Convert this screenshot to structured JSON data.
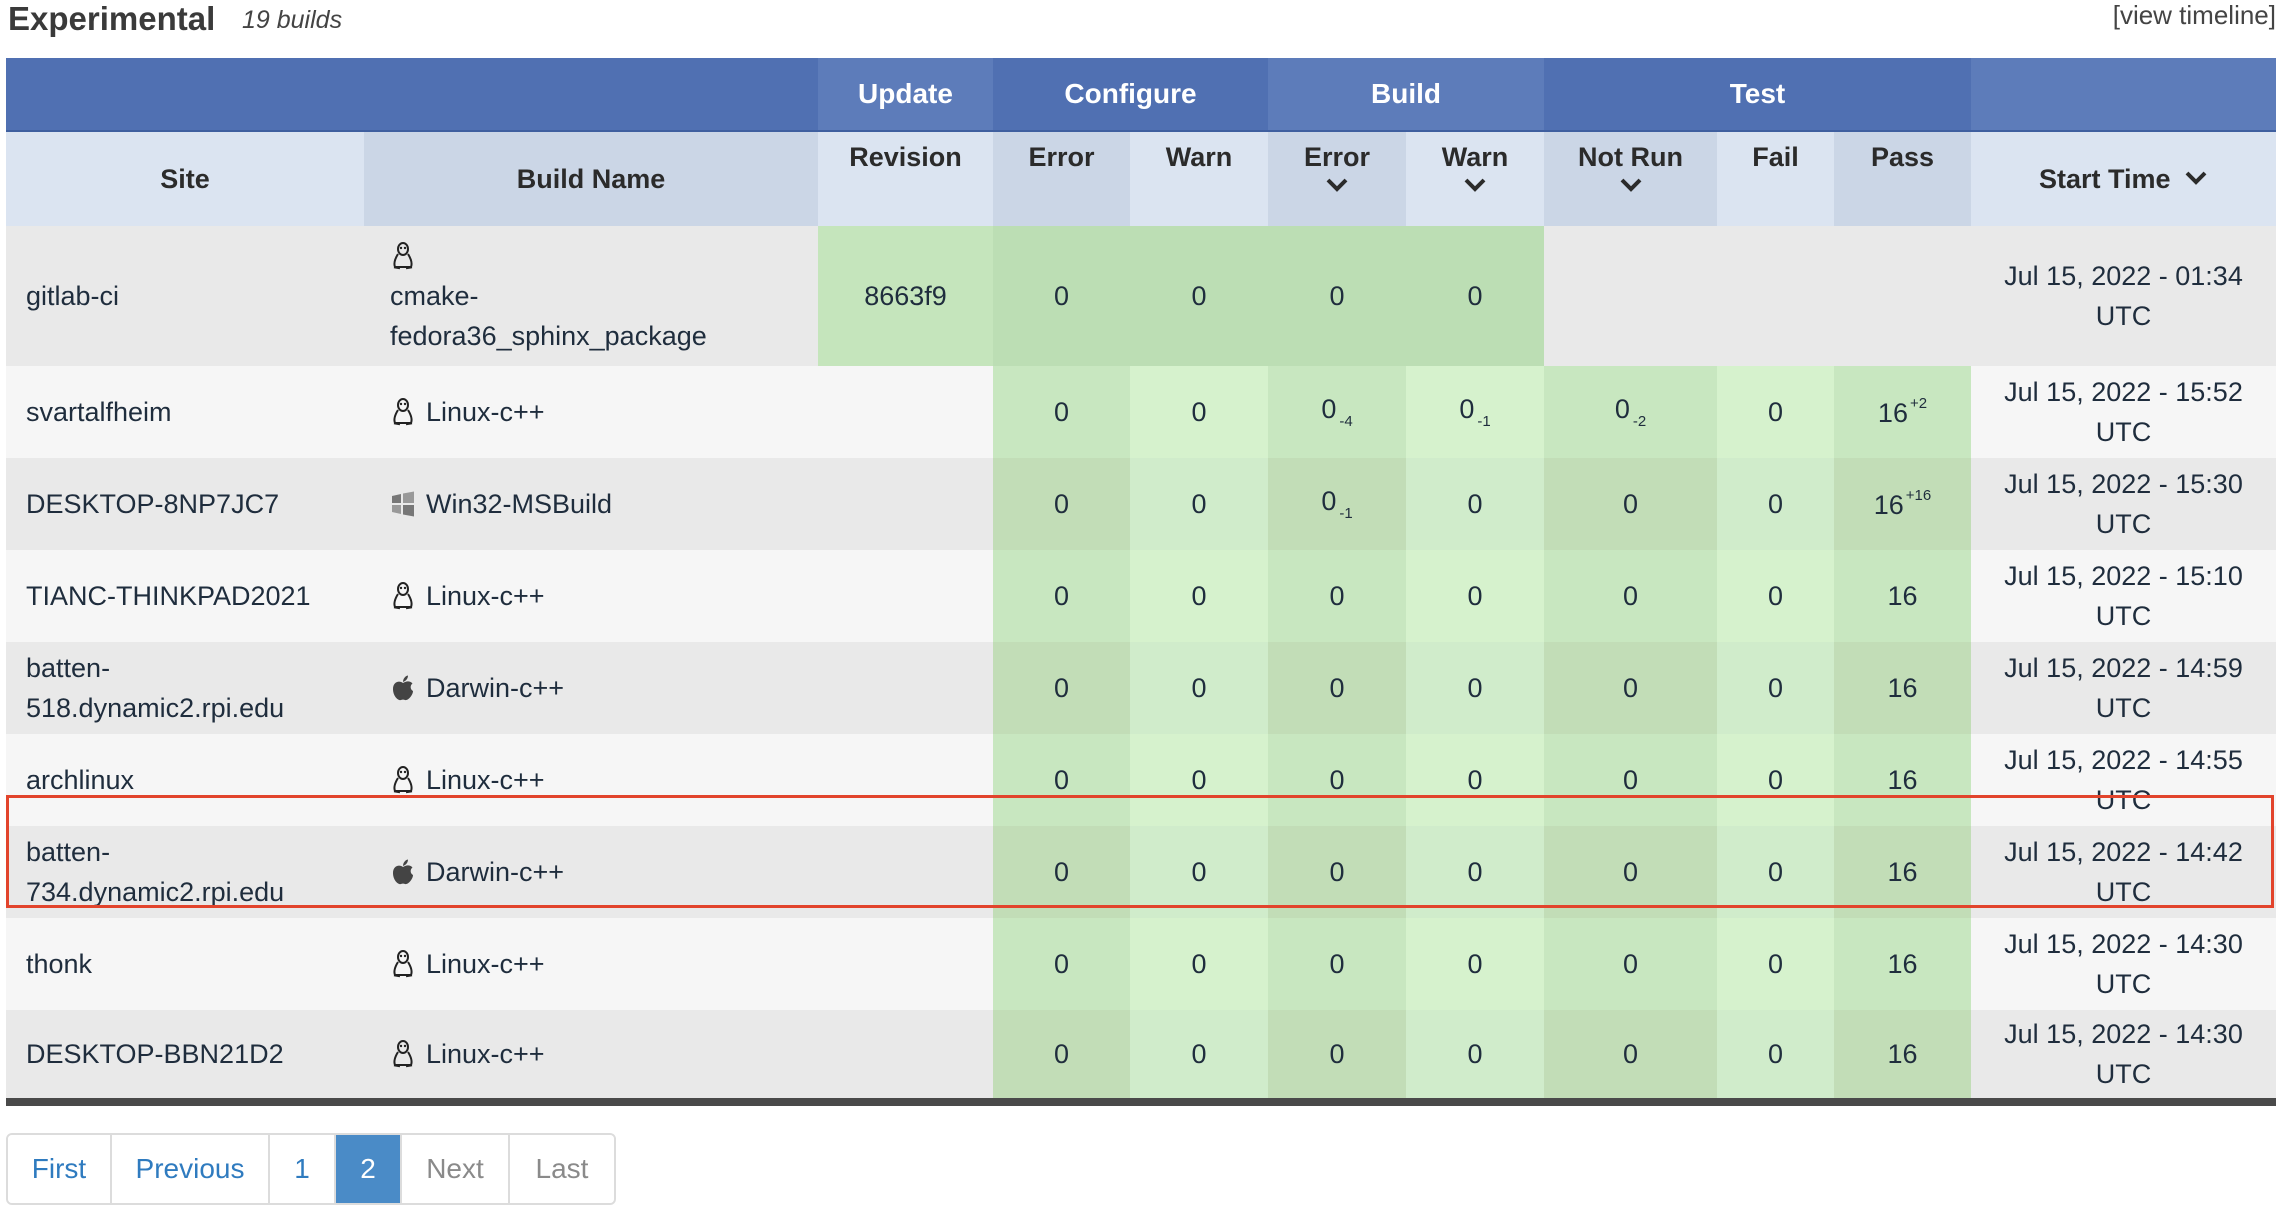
{
  "header": {
    "title": "Experimental",
    "subtitle": "19 builds",
    "view_timeline": "[view timeline]"
  },
  "table": {
    "groups": {
      "update": "Update",
      "configure": "Configure",
      "build": "Build",
      "test": "Test"
    },
    "columns": {
      "site": "Site",
      "build_name": "Build Name",
      "revision": "Revision",
      "configure_error": "Error",
      "configure_warn": "Warn",
      "build_error": "Error",
      "build_warn": "Warn",
      "not_run": "Not Run",
      "fail": "Fail",
      "pass": "Pass",
      "start_time": "Start Time"
    },
    "rows": [
      {
        "site": "gitlab-ci",
        "os_icon": "linux-icon",
        "build_name_l1": "cmake-",
        "build_name_l2": "fedora36_sphinx_package",
        "revision": "8663f9",
        "cfg_error": "0",
        "cfg_warn": "0",
        "build_error": "0",
        "build_error_delta": "",
        "build_warn": "0",
        "build_warn_delta": "",
        "not_run": "",
        "not_run_delta": "",
        "fail": "",
        "pass": "",
        "pass_delta": "",
        "time_l1": "Jul 15, 2022 - 01:34",
        "time_l2": "UTC"
      },
      {
        "site": "svartalfheim",
        "os_icon": "linux-icon",
        "build_name": "Linux-c++",
        "revision": "",
        "cfg_error": "0",
        "cfg_warn": "0",
        "build_error": "0",
        "build_error_delta": "-4",
        "build_warn": "0",
        "build_warn_delta": "-1",
        "not_run": "0",
        "not_run_delta": "-2",
        "fail": "0",
        "pass": "16",
        "pass_delta": "+2",
        "time_l1": "Jul 15, 2022 - 15:52",
        "time_l2": "UTC"
      },
      {
        "site": "DESKTOP-8NP7JC7",
        "os_icon": "windows-icon",
        "build_name": "Win32-MSBuild",
        "revision": "",
        "cfg_error": "0",
        "cfg_warn": "0",
        "build_error": "0",
        "build_error_delta": "-1",
        "build_warn": "0",
        "build_warn_delta": "",
        "not_run": "0",
        "not_run_delta": "",
        "fail": "0",
        "pass": "16",
        "pass_delta": "+16",
        "time_l1": "Jul 15, 2022 - 15:30",
        "time_l2": "UTC"
      },
      {
        "site": "TIANC-THINKPAD2021",
        "os_icon": "linux-icon",
        "build_name": "Linux-c++",
        "revision": "",
        "cfg_error": "0",
        "cfg_warn": "0",
        "build_error": "0",
        "build_error_delta": "",
        "build_warn": "0",
        "build_warn_delta": "",
        "not_run": "0",
        "not_run_delta": "",
        "fail": "0",
        "pass": "16",
        "pass_delta": "",
        "time_l1": "Jul 15, 2022 - 15:10",
        "time_l2": "UTC"
      },
      {
        "site_l1": "batten-",
        "site_l2": "518.dynamic2.rpi.edu",
        "os_icon": "apple-icon",
        "build_name": "Darwin-c++",
        "revision": "",
        "cfg_error": "0",
        "cfg_warn": "0",
        "build_error": "0",
        "build_error_delta": "",
        "build_warn": "0",
        "build_warn_delta": "",
        "not_run": "0",
        "not_run_delta": "",
        "fail": "0",
        "pass": "16",
        "pass_delta": "",
        "time_l1": "Jul 15, 2022 - 14:59",
        "time_l2": "UTC"
      },
      {
        "site": "archlinux",
        "os_icon": "linux-icon",
        "build_name": "Linux-c++",
        "revision": "",
        "cfg_error": "0",
        "cfg_warn": "0",
        "build_error": "0",
        "build_error_delta": "",
        "build_warn": "0",
        "build_warn_delta": "",
        "not_run": "0",
        "not_run_delta": "",
        "fail": "0",
        "pass": "16",
        "pass_delta": "",
        "time_l1": "Jul 15, 2022 - 14:55",
        "time_l2": "UTC"
      },
      {
        "site_l1": "batten-",
        "site_l2": "734.dynamic2.rpi.edu",
        "os_icon": "apple-icon",
        "build_name": "Darwin-c++",
        "revision": "",
        "cfg_error": "0",
        "cfg_warn": "0",
        "build_error": "0",
        "build_error_delta": "",
        "build_warn": "0",
        "build_warn_delta": "",
        "not_run": "0",
        "not_run_delta": "",
        "fail": "0",
        "pass": "16",
        "pass_delta": "",
        "time_l1": "Jul 15, 2022 - 14:42",
        "time_l2": "UTC"
      },
      {
        "site": "thonk",
        "os_icon": "linux-icon",
        "build_name": "Linux-c++",
        "revision": "",
        "cfg_error": "0",
        "cfg_warn": "0",
        "build_error": "0",
        "build_error_delta": "",
        "build_warn": "0",
        "build_warn_delta": "",
        "not_run": "0",
        "not_run_delta": "",
        "fail": "0",
        "pass": "16",
        "pass_delta": "",
        "time_l1": "Jul 15, 2022 - 14:30",
        "time_l2": "UTC"
      },
      {
        "site": "DESKTOP-BBN21D2",
        "os_icon": "linux-icon",
        "build_name": "Linux-c++",
        "revision": "",
        "cfg_error": "0",
        "cfg_warn": "0",
        "build_error": "0",
        "build_error_delta": "",
        "build_warn": "0",
        "build_warn_delta": "",
        "not_run": "0",
        "not_run_delta": "",
        "fail": "0",
        "pass": "16",
        "pass_delta": "",
        "time_l1": "Jul 15, 2022 - 14:30",
        "time_l2": "UTC"
      }
    ]
  },
  "pagination": {
    "first": "First",
    "previous": "Previous",
    "page1": "1",
    "page2": "2",
    "next": "Next",
    "last": "Last",
    "current_page": "2"
  },
  "colors": {
    "header_blue": "#5d7cba",
    "column_header": "#dbe4f1",
    "pass_green": "#d0eccb",
    "highlight_red": "#e2442c",
    "link_blue": "#2f7bbf",
    "active_page": "#4a8bc7"
  }
}
